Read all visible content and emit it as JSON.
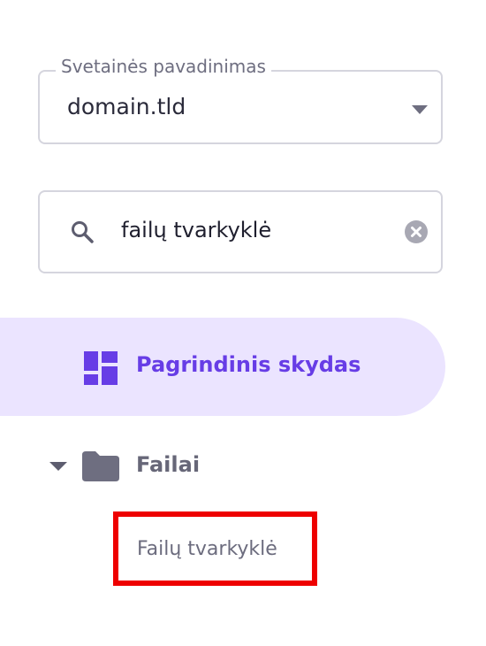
{
  "site_select": {
    "legend": "Svetainės pavadinimas",
    "value": "domain.tld"
  },
  "search": {
    "value": "failų tvarkyklė"
  },
  "nav": {
    "active_item": {
      "label": "Pagrindinis skydas",
      "icon": "dashboard-icon"
    },
    "group": {
      "label": "Failai",
      "icon": "folder-icon",
      "expanded": true,
      "children": [
        {
          "label": "Failų tvarkyklė",
          "highlighted": true
        }
      ]
    }
  },
  "colors": {
    "accent": "#673de6",
    "active_bg": "#ebe4ff",
    "highlight_border": "#ee0000",
    "muted": "#6e6e80"
  }
}
